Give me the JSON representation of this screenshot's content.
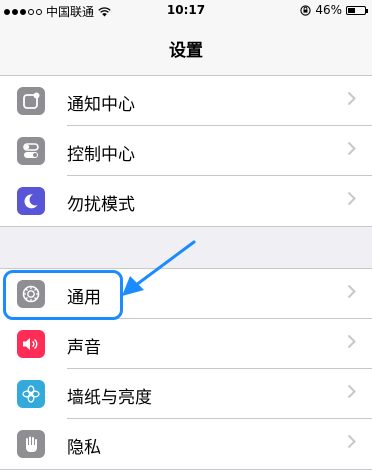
{
  "status_bar": {
    "carrier": "中国联通",
    "time": "10:17",
    "battery_percent": "46%",
    "battery_level": 0.46,
    "signal_dots_filled": 3,
    "signal_dots_total": 5
  },
  "nav": {
    "title": "设置"
  },
  "settings": {
    "group1": [
      {
        "label": "通知中心",
        "icon": "notification-center-icon",
        "color": "#8e8e93"
      },
      {
        "label": "控制中心",
        "icon": "control-center-icon",
        "color": "#8e8e93"
      },
      {
        "label": "勿扰模式",
        "icon": "do-not-disturb-icon",
        "color": "#5856d6"
      }
    ],
    "group2": [
      {
        "label": "通用",
        "icon": "gear-icon",
        "color": "#8e8e93"
      },
      {
        "label": "声音",
        "icon": "speaker-icon",
        "color": "#ff2d55"
      },
      {
        "label": "墙纸与亮度",
        "icon": "wallpaper-icon",
        "color": "#34aadc"
      },
      {
        "label": "隐私",
        "icon": "privacy-hand-icon",
        "color": "#8e8e93"
      }
    ]
  },
  "annotation": {
    "color": "#1a8cff",
    "highlighted_item": "通用"
  }
}
